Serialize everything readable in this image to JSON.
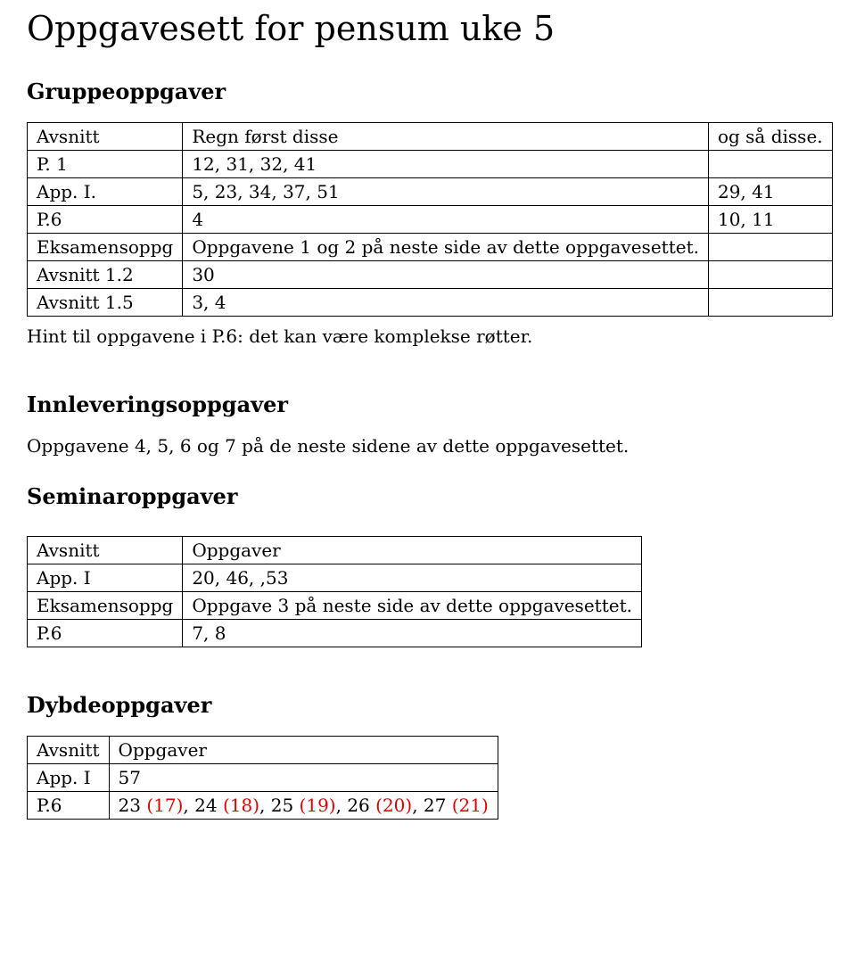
{
  "title": "Oppgavesett for pensum uke 5",
  "sections": {
    "gruppe": {
      "heading": "Gruppeoppgaver",
      "header": {
        "c0": "Avsnitt",
        "c1": "Regn først disse",
        "c2": "og så disse."
      },
      "rows": [
        {
          "c0": "P. 1",
          "c1": "12, 31, 32, 41",
          "c2": ""
        },
        {
          "c0": "App. I.",
          "c1": "5, 23, 34, 37, 51",
          "c2": "29, 41"
        },
        {
          "c0": "P.6",
          "c1": "4",
          "c2": "10, 11"
        },
        {
          "c0": "Eksamensoppg",
          "c1": "Oppgavene 1 og 2 på neste side av dette oppgavesettet.",
          "c2": ""
        },
        {
          "c0": "Avsnitt 1.2",
          "c1": "30",
          "c2": ""
        },
        {
          "c0": "Avsnitt 1.5",
          "c1": "3, 4",
          "c2": ""
        }
      ],
      "hint": "Hint til oppgavene i P.6: det kan være komplekse røtter."
    },
    "innlevering": {
      "heading": "Innleveringsoppgaver",
      "text": "Oppgavene 4, 5, 6 og 7 på de neste sidene av dette oppgavesettet."
    },
    "seminar": {
      "heading": "Seminaroppgaver",
      "header": {
        "c0": "Avsnitt",
        "c1": "Oppgaver"
      },
      "rows": [
        {
          "c0": "App. I",
          "c1": "20, 46, ,53"
        },
        {
          "c0": "Eksamensoppg",
          "c1": "Oppgave 3 på neste side av dette oppgavesettet."
        },
        {
          "c0": "P.6",
          "c1": "7, 8"
        }
      ]
    },
    "dybde": {
      "heading": "Dybdeoppgaver",
      "header": {
        "c0": "Avsnitt",
        "c1": "Oppgaver"
      },
      "rows": [
        {
          "c0": "App. I",
          "c1": "57"
        },
        {
          "c0": "P.6",
          "c1_prefix": "23 ",
          "c1_red": "(17)",
          "c1_a": ", 24 ",
          "c1_red2": "(18)",
          "c1_b": ", 25 ",
          "c1_red3": "(19)",
          "c1_c": ", 26 ",
          "c1_red4": "(20)",
          "c1_d": ", 27 ",
          "c1_red5": "(21)"
        }
      ]
    }
  }
}
